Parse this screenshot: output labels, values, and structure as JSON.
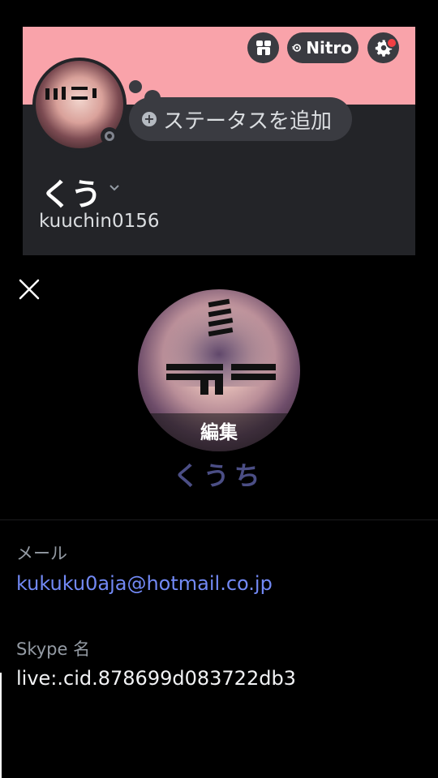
{
  "profile_card": {
    "banner_color": "#f9a3aa",
    "nitro_label": "Nitro",
    "status_placeholder": "ステータスを追加",
    "display_name": "くう",
    "username": "kuuchin0156",
    "status": "offline",
    "icons": {
      "shop": "shop-icon",
      "nitro": "nitro-icon",
      "settings": "gear-icon",
      "add_status": "plus-circle-icon",
      "name_menu": "chevron-down-icon"
    }
  },
  "edit_profile": {
    "avatar_edit_label": "編集",
    "nickname": "くうち",
    "close_icon": "close-icon"
  },
  "fields": {
    "email_label": "メール",
    "email_value": "kukuku0aja@hotmail.co.jp",
    "skype_label": "Skype 名",
    "skype_value": "live:.cid.878699d083722db3"
  },
  "colors": {
    "accent_link": "#7289f5",
    "nickname": "#4b4e85",
    "card_bg": "#232428"
  }
}
